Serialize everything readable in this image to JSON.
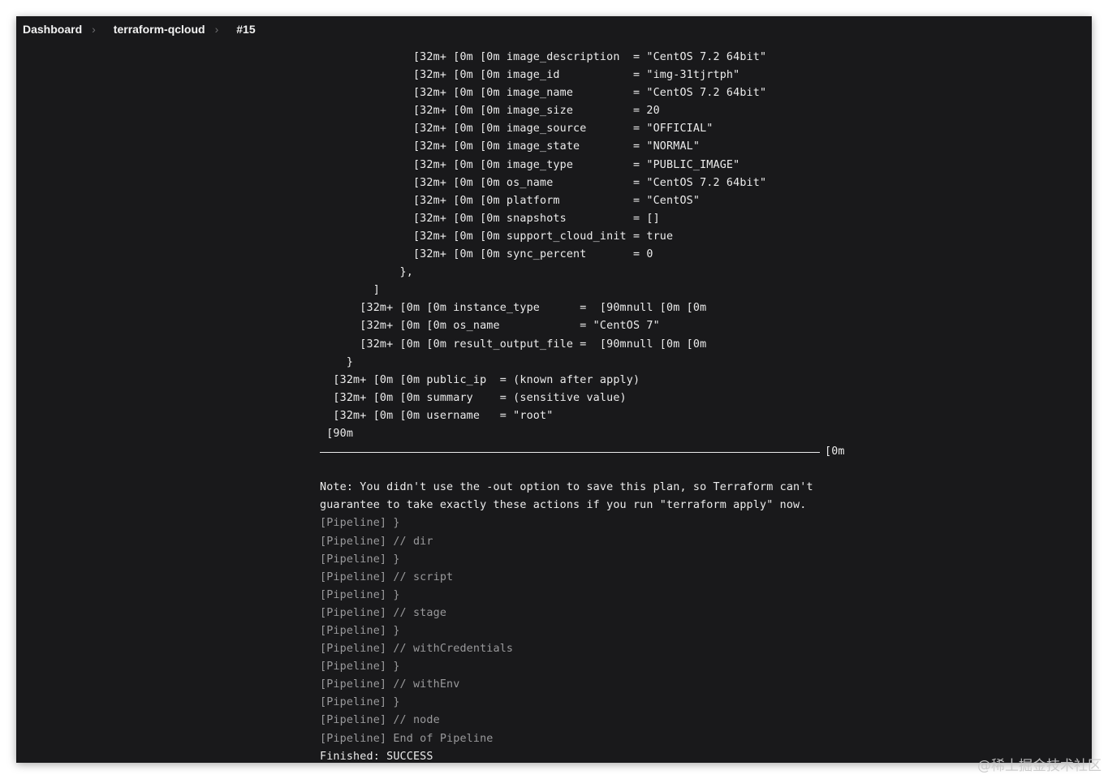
{
  "breadcrumb": {
    "items": [
      "Dashboard",
      "terraform-qcloud",
      "#15"
    ]
  },
  "console": {
    "lines": [
      "              [32m+ [0m [0m image_description  = \"CentOS 7.2 64bit\"",
      "              [32m+ [0m [0m image_id           = \"img-31tjrtph\"",
      "              [32m+ [0m [0m image_name         = \"CentOS 7.2 64bit\"",
      "              [32m+ [0m [0m image_size         = 20",
      "              [32m+ [0m [0m image_source       = \"OFFICIAL\"",
      "              [32m+ [0m [0m image_state        = \"NORMAL\"",
      "              [32m+ [0m [0m image_type         = \"PUBLIC_IMAGE\"",
      "              [32m+ [0m [0m os_name            = \"CentOS 7.2 64bit\"",
      "              [32m+ [0m [0m platform           = \"CentOS\"",
      "              [32m+ [0m [0m snapshots          = []",
      "              [32m+ [0m [0m support_cloud_init = true",
      "              [32m+ [0m [0m sync_percent       = 0",
      "            },",
      "        ]",
      "      [32m+ [0m [0m instance_type      =  [90mnull [0m [0m",
      "      [32m+ [0m [0m os_name            = \"CentOS 7\"",
      "      [32m+ [0m [0m result_output_file =  [90mnull [0m [0m",
      "    }",
      "  [32m+ [0m [0m public_ip  = (known after apply)",
      "  [32m+ [0m [0m summary    = (sensitive value)",
      "  [32m+ [0m [0m username   = \"root\"",
      " [90m"
    ],
    "rule_tail": "[0m",
    "note_lines": [
      "",
      "Note: You didn't use the -out option to save this plan, so Terraform can't",
      "guarantee to take exactly these actions if you run \"terraform apply\" now."
    ],
    "pipeline_lines": [
      "[Pipeline] }",
      "[Pipeline] // dir",
      "[Pipeline] }",
      "[Pipeline] // script",
      "[Pipeline] }",
      "[Pipeline] // stage",
      "[Pipeline] }",
      "[Pipeline] // withCredentials",
      "[Pipeline] }",
      "[Pipeline] // withEnv",
      "[Pipeline] }",
      "[Pipeline] // node",
      "[Pipeline] End of Pipeline"
    ],
    "final_line": "Finished: SUCCESS"
  },
  "watermark": "@稀土掘金技术社区",
  "colors": {
    "background": "#19191b",
    "text": "#ececec",
    "dim_text": "#9a9a9c"
  }
}
